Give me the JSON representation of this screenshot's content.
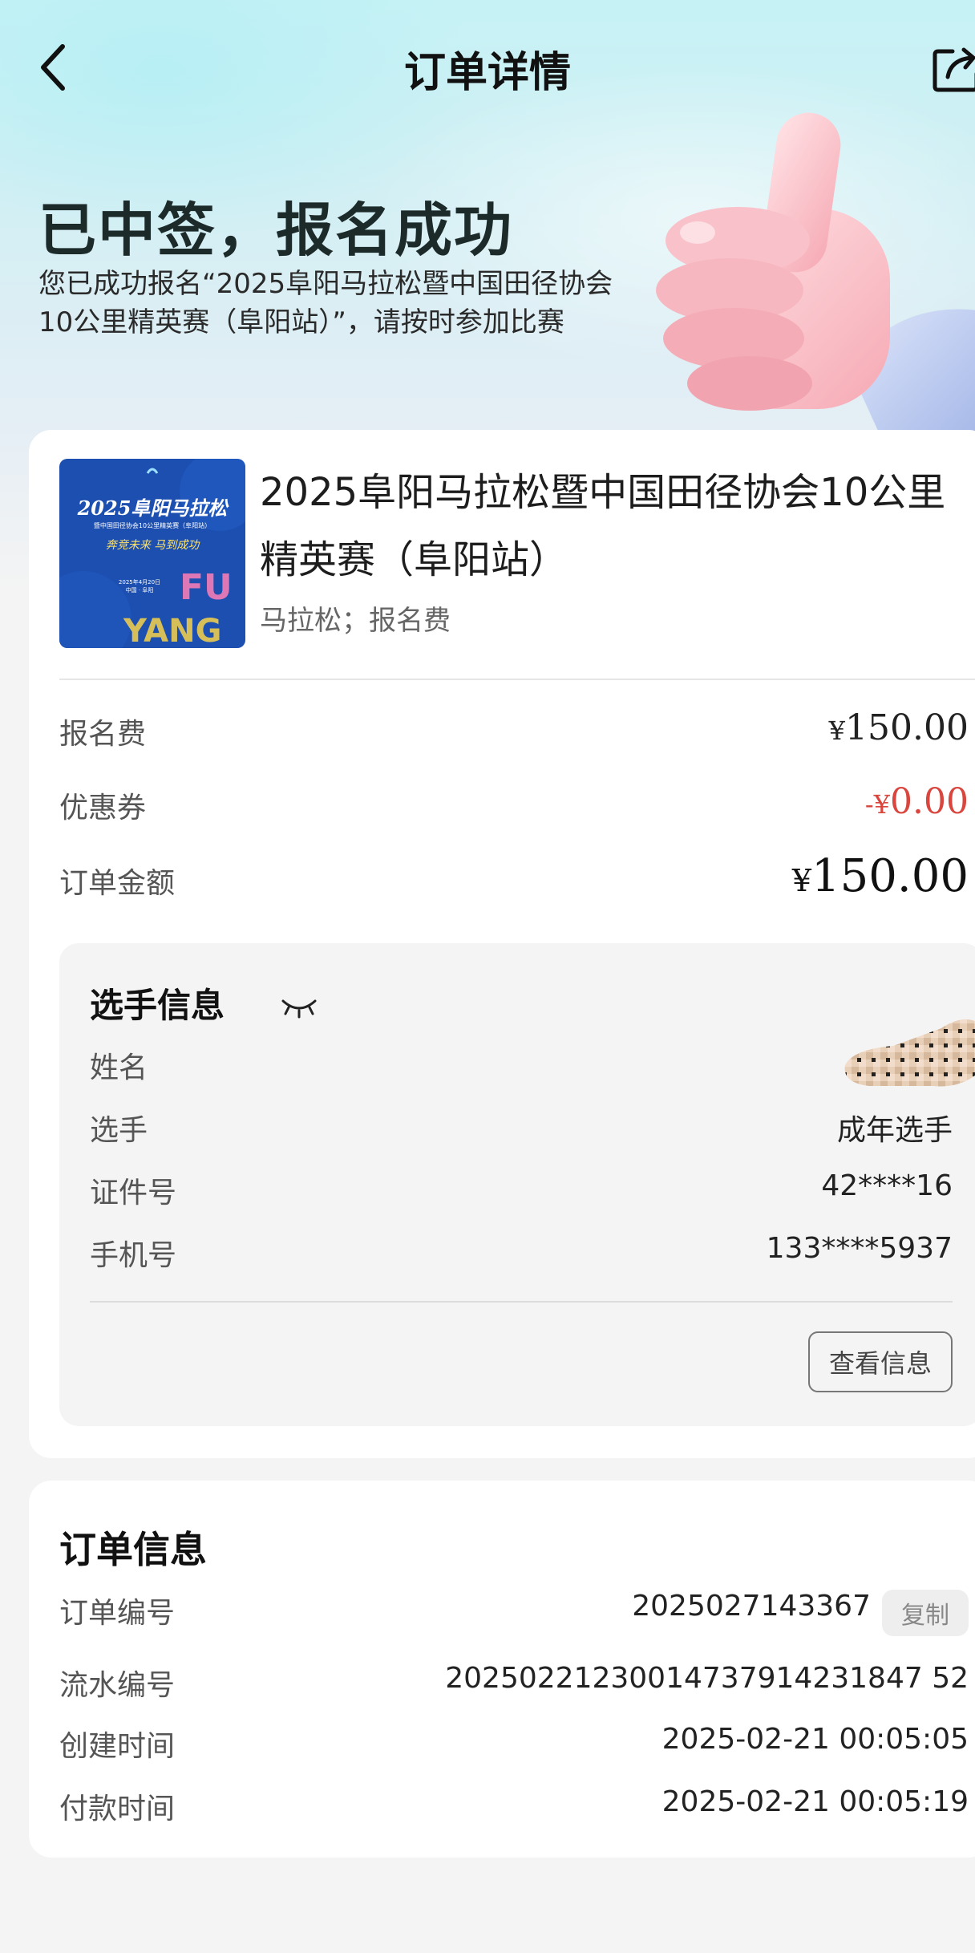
{
  "header": {
    "title": "订单详情",
    "back_icon": "chevron-left-icon",
    "share_icon": "share-icon"
  },
  "status": {
    "title": "已中签，报名成功",
    "description": "您已成功报名“2025阜阳马拉松暨中国田径协会10公里精英赛（阜阳站）”，请按时参加比赛"
  },
  "event": {
    "poster_text": {
      "year_title": "2025阜阳马拉松",
      "subtitle": "暨中国田径协会10公里精英赛（阜阳站）",
      "slogan": "奔竞未来 马到成功",
      "date": "2025年4月20日",
      "place": "中国 · 阜阳",
      "brand": "FU YANG"
    },
    "title": "2025阜阳马拉松暨中国田径协会10公里精英赛（阜阳站）",
    "tags": "马拉松；报名费"
  },
  "pricing": {
    "fee_label": "报名费",
    "fee_value": "150.00",
    "coupon_label": "优惠券",
    "coupon_value": "0.00",
    "total_label": "订单金额",
    "total_value": "150.00",
    "currency": "¥",
    "minus_currency": "-¥",
    "coupon_color": "#d9463e"
  },
  "player": {
    "title": "选手信息",
    "eye_icon": "eye-closed-icon",
    "name_label": "姓名",
    "type_label": "选手",
    "type_value": "成年选手",
    "id_label": "证件号",
    "id_value": "42****16",
    "phone_label": "手机号",
    "phone_value": "133****5937",
    "view_button": "查看信息"
  },
  "order_info": {
    "title": "订单信息",
    "order_no_label": "订单编号",
    "order_no_value": "2025027143367",
    "copy_button": "复制",
    "serial_label": "流水编号",
    "serial_value": "20250221230014737914231847 52",
    "created_label": "创建时间",
    "created_value": "2025-02-21 00:05:05",
    "paid_label": "付款时间",
    "paid_value": "2025-02-21 00:05:19"
  }
}
